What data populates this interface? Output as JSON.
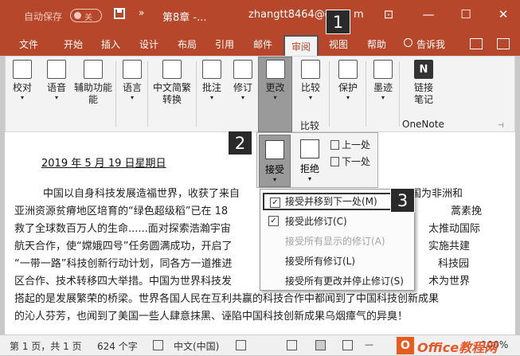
{
  "titlebar": {
    "autosave_label": "自动保存",
    "autosave_state": "关",
    "doc_title": "第8章 -...",
    "account": "zhangtt8464@outlo",
    "account_tail": "m",
    "controls": [
      "⊡",
      "—",
      "☐",
      "✕"
    ]
  },
  "tabs": [
    "文件",
    "开始",
    "插入",
    "设计",
    "布局",
    "引用",
    "邮件",
    "审阅",
    "视图",
    "帮助"
  ],
  "active_tab": "审阅",
  "tell_me": "告诉我",
  "ribbon": {
    "buttons": [
      {
        "label": "校对",
        "icon": "spelling-icon"
      },
      {
        "label": "语音",
        "icon": "read-aloud-icon"
      },
      {
        "label": "辅助功能",
        "label2": "能",
        "icon": "accessibility-icon"
      },
      {
        "label": "语言",
        "icon": "language-icon"
      },
      {
        "label": "中文简繁",
        "label2": "转换",
        "icon": "chinese-conversion-icon"
      },
      {
        "label": "批注",
        "icon": "comment-icon"
      },
      {
        "label": "修订",
        "icon": "track-changes-icon"
      },
      {
        "label": "更改",
        "icon": "changes-icon"
      },
      {
        "label": "比较",
        "icon": "compare-icon"
      },
      {
        "label": "保护",
        "icon": "protect-icon"
      },
      {
        "label": "墨迹",
        "icon": "ink-icon"
      },
      {
        "label": "链接",
        "label2": "笔记",
        "icon": "onenote-icon"
      }
    ],
    "compare_group_label": "比较",
    "onenote_group_label": "OneNote"
  },
  "panel": {
    "accept_label": "接受",
    "reject_label": "拒绝",
    "prev_label": "上一处",
    "next_label": "下一处"
  },
  "menu": {
    "items": [
      {
        "label": "接受并移到下一处(M)",
        "enabled": true,
        "highlight": true
      },
      {
        "label": "接受此修订(C)",
        "enabled": true
      },
      {
        "label": "接受所有显示的修订(A)",
        "enabled": false
      },
      {
        "label": "接受所有修订(L)",
        "enabled": true
      },
      {
        "label": "接受所有更改并停止修订(S)",
        "enabled": true
      }
    ]
  },
  "document": {
    "date": "2019 年 5 月 19 日星期日",
    "lines": [
      {
        "left": "中国以自身科技发展造福世界，收获了来自",
        "right": "国为非洲和"
      },
      {
        "left": "亚洲资源贫瘠地区培育的“绿色超级稻”已在 18",
        "right": "蒿素挽"
      },
      {
        "left": "救了全球数百万人的生命......面对探索浩瀚宇宙",
        "right": "太推动国际"
      },
      {
        "left": "航天合作，使“嫦娥四号”任务圆满成功，开启了",
        "right": "实施共建"
      },
      {
        "left": "“一带一路”科技创新行动计划，同各方一道推进",
        "right": "科技园"
      },
      {
        "left": "区合作、技术转移四大举措。中国为世界科技发",
        "right": "术为世界"
      },
      {
        "full": "搭起的是发展繁荣的桥梁。世界各国人民在互利共赢的科技合作中都闻到了中国科技创新成果"
      },
      {
        "full": "的沁人芬芳，也闻到了美国一些人肆意抹黑、诬陷中国科技创新成果乌烟瘴气的异臭！"
      }
    ]
  },
  "badges": [
    "1",
    "2",
    "3"
  ],
  "status": {
    "page": "第 1 页，共 1 页",
    "words": "624 个字",
    "language": "中文(中国)",
    "zoom": "100%"
  },
  "watermark": {
    "logo": "O",
    "text": "Office教程网"
  }
}
